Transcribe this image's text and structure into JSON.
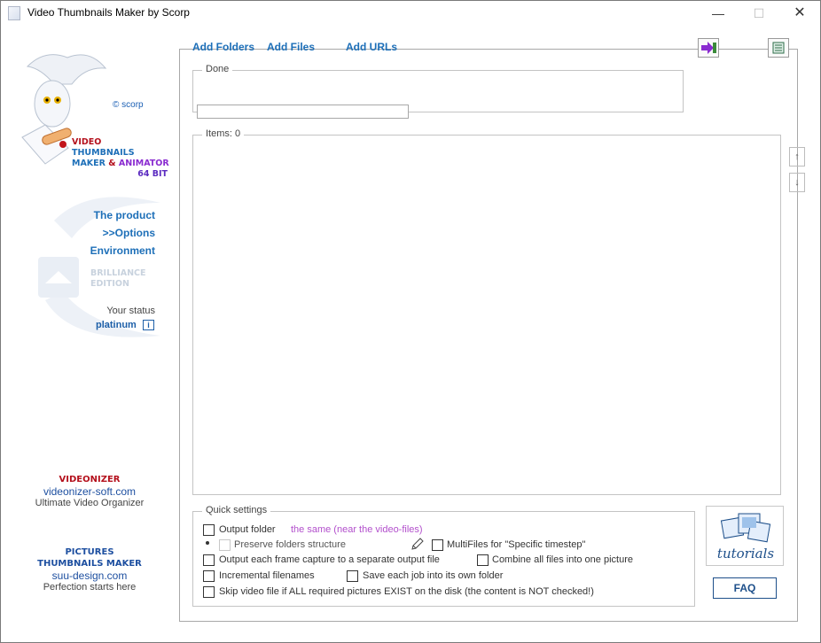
{
  "window": {
    "title": "Video Thumbnails Maker by Scorp",
    "minimize": "—",
    "maximize": "☐",
    "close": "✕"
  },
  "left": {
    "copyright": "© scorp",
    "brand": {
      "line1": "VIDEO",
      "line2": "THUMBNAILS",
      "line3a": "MAKER",
      "line3b": "&",
      "line3c": "ANIMATOR",
      "line4": "64 BIT"
    },
    "nav": [
      {
        "label": "The product"
      },
      {
        "label": ">>Options"
      },
      {
        "label": "Environment"
      }
    ],
    "edition": {
      "line1": "BRILLIANCE",
      "line2": "EDITION"
    },
    "status_label": "Your status",
    "status_value": "platinum",
    "promo1": {
      "title": "VIDEONIZER",
      "site": "videonizer-soft.com",
      "tagline": "Ultimate Video Organizer"
    },
    "promo2": {
      "title1": "PICTURES",
      "title2": "THUMBNAILS MAKER",
      "site": "suu-design.com",
      "tagline": "Perfection starts here"
    }
  },
  "toolbar": {
    "add_folders": "Add Folders",
    "add_files": "Add Files",
    "add_urls": "Add URLs"
  },
  "status_group": {
    "label": "Done",
    "progress": 0
  },
  "items_group": {
    "label": "Items: 0",
    "move_up": "↑",
    "move_down": "↓"
  },
  "quick_settings": {
    "label": "Quick settings",
    "output_folder": {
      "label": "Output folder",
      "value": "the same (near the video-files)",
      "checked": false
    },
    "preserve_structure": {
      "label": "Preserve folders structure",
      "checked": false
    },
    "multifiles": {
      "label": "MultiFiles for \"Specific timestep\"",
      "checked": false
    },
    "each_frame": {
      "label": "Output each frame capture to a separate output file",
      "checked": false
    },
    "combine_all": {
      "label": "Combine all files into one picture",
      "checked": false
    },
    "incremental": {
      "label": "Incremental filenames",
      "checked": false
    },
    "each_job": {
      "label": "Save each job into its own folder",
      "checked": false
    },
    "skip_video": {
      "label": "Skip video file if ALL required pictures EXIST on the disk (the content is NOT checked!)",
      "checked": false
    }
  },
  "tutorials_label": "tutorials",
  "faq_label": "FAQ",
  "colors": {
    "link": "#1d6fb8",
    "accent_red": "#b4101c",
    "accent_purple": "#b24fcc"
  }
}
